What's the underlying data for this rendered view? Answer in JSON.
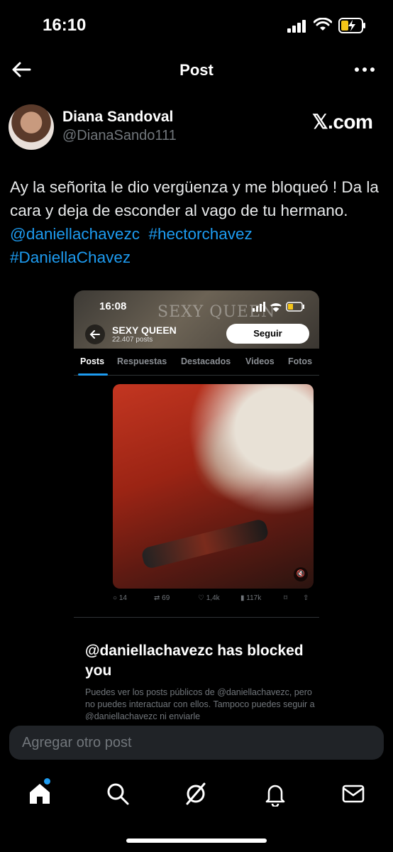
{
  "status_bar": {
    "time": "16:10"
  },
  "header": {
    "title": "Post"
  },
  "author": {
    "name": "Diana Sandoval",
    "handle": "@DianaSando111",
    "source": "𝕏.com"
  },
  "post": {
    "line1": "Ay la señorita le dio vergüenza y me bloqueó ! Da la cara y deja de esconder al vago de tu hermano.",
    "mention": "@daniellachavezc",
    "hashtag1": "#hectorchavez",
    "hashtag2": "#DaniellaChavez"
  },
  "embed": {
    "time": "16:08",
    "watermark": "SEXY QUEEN",
    "profile_name": "SEXY QUEEN",
    "profile_posts": "22.407 posts",
    "follow_label": "Seguir",
    "tabs": [
      "Posts",
      "Respuestas",
      "Destacados",
      "Videos",
      "Fotos"
    ],
    "actions": {
      "replies": "14",
      "reposts": "69",
      "likes": "1,4k",
      "views": "117k"
    },
    "blocked_title": "@daniellachavezc has blocked you",
    "blocked_desc": "Puedes ver los posts públicos de @daniellachavezc, pero no puedes interactuar con ellos. Tampoco puedes seguir a @daniellachavezc ni enviarle"
  },
  "reply": {
    "placeholder": "Agregar otro post"
  },
  "nav": [
    "home-icon",
    "search-icon",
    "grok-icon",
    "notifications-icon",
    "messages-icon"
  ],
  "colors": {
    "accent": "#1d9bf0",
    "background": "#000000",
    "muted": "#71767b"
  }
}
